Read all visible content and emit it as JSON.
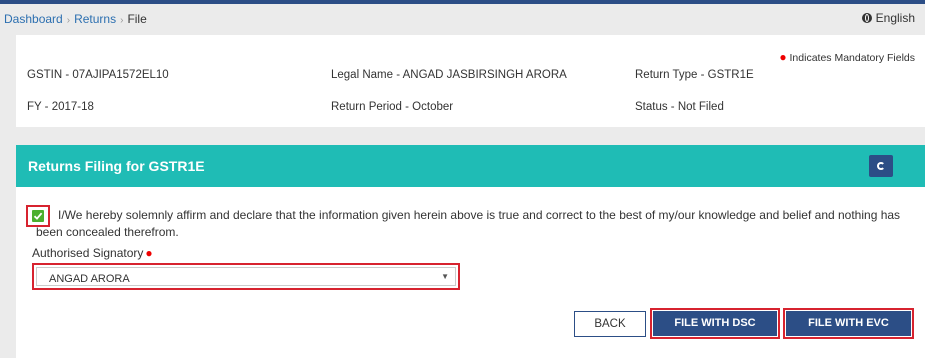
{
  "breadcrumb": {
    "items": [
      "Dashboard",
      "Returns"
    ],
    "current": "File",
    "separator": "›"
  },
  "language": "English",
  "info": {
    "mandatory_note": "Indicates Mandatory Fields",
    "gstin": "GSTIN - 07AJIPA1572EL10",
    "legal_name": "Legal Name - ANGAD JASBIRSINGH ARORA",
    "return_type": "Return Type - GSTR1E",
    "fy": "FY - 2017-18",
    "return_period": "Return Period - October",
    "status": "Status - Not Filed"
  },
  "filing": {
    "title": "Returns Filing for GSTR1E",
    "declaration_checked": true,
    "declaration": "I/We hereby solemnly affirm and declare that the information given herein above is true and correct to the best of my/our knowledge and belief and nothing has been concealed therefrom.",
    "signatory_label": "Authorised Signatory",
    "signatory_value": "ANGAD ARORA"
  },
  "buttons": {
    "back": "BACK",
    "file_dsc": "FILE WITH DSC",
    "file_evc": "FILE WITH EVC"
  },
  "colors": {
    "primary": "#2c4e86",
    "header_teal": "#1fbcb5",
    "highlight_red": "#d7232f",
    "check_green": "#4caf2e"
  },
  "icons": {
    "language": "globe-icon",
    "refresh": "refresh-icon",
    "required": "required-dot-icon",
    "dropdown": "caret-down-icon"
  }
}
